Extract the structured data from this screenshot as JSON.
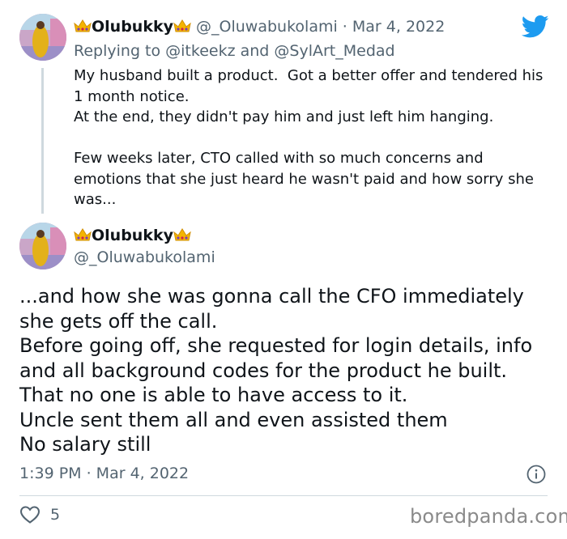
{
  "tweet_parent": {
    "display_name": "Olubukky",
    "handle": "@_Oluwabukolami",
    "separator": " · ",
    "date": "Mar 4, 2022",
    "replying_prefix": "Replying to ",
    "mention_1": "@itkeekz",
    "replying_join": " and ",
    "mention_2": "@SylArt_Medad",
    "text": "My husband built a product.  Got a better offer and tendered his 1 month notice.\nAt the end, they didn't pay him and just left him hanging.\n\nFew weeks later, CTO called with so much concerns and emotions that she just heard he wasn't paid and how sorry she was..."
  },
  "tweet_main": {
    "display_name": "Olubukky",
    "handle": "@_Oluwabukolami",
    "text": "...and how she was gonna call the CFO immediately she gets off the call.\nBefore going off, she requested for login details, info and all background codes for the product he built. That no one is able to have access to it.\nUncle sent them all and even assisted them\nNo salary still",
    "timestamp": "1:39 PM · Mar 4, 2022",
    "like_count": "5"
  },
  "watermark": "boredpanda.com",
  "icons": {
    "brand": "twitter-bird-icon",
    "name_decoration": "crown-emoji-icon",
    "info": "info-icon",
    "like": "heart-icon"
  },
  "colors": {
    "twitter_blue": "#1d9bf0",
    "text": "#0f1419",
    "muted": "#536471",
    "divider": "#cfd9de",
    "watermark": "#8a8a8a"
  }
}
